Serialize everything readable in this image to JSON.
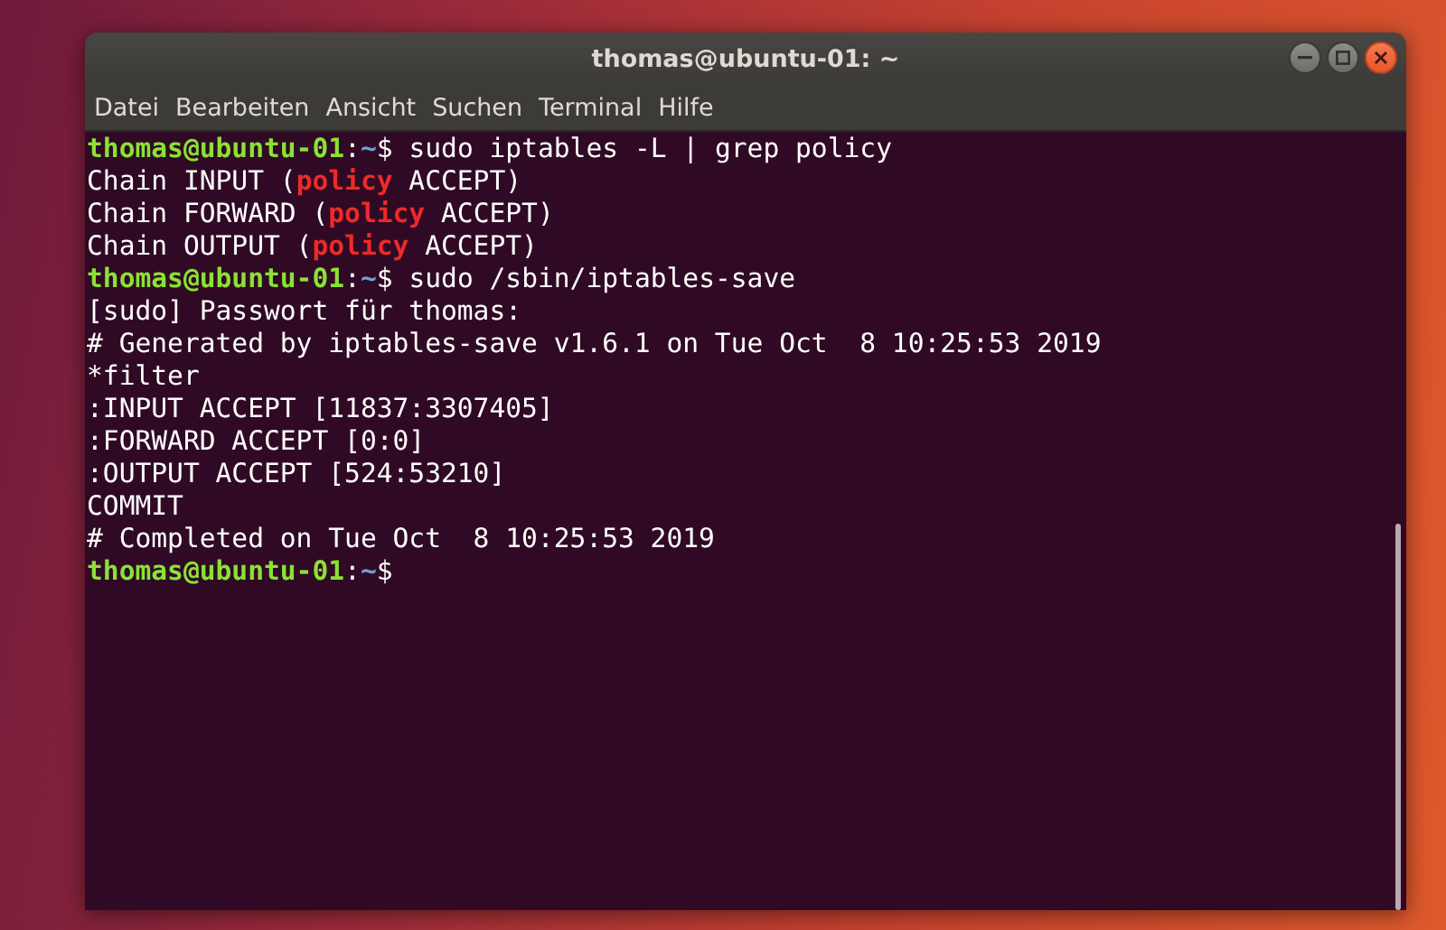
{
  "window": {
    "title": "thomas@ubuntu-01: ~"
  },
  "menu": [
    "Datei",
    "Bearbeiten",
    "Ansicht",
    "Suchen",
    "Terminal",
    "Hilfe"
  ],
  "lines": [
    {
      "kind": "prompt",
      "user_host": "thomas@ubuntu-01",
      "separator": ":",
      "path": "~",
      "symbol": "$",
      "command": " sudo iptables -L | grep policy"
    },
    {
      "kind": "output",
      "segments": [
        {
          "kind": "plain",
          "text": "Chain INPUT ("
        },
        {
          "kind": "match",
          "text": "policy"
        },
        {
          "kind": "plain",
          "text": " ACCEPT)"
        }
      ]
    },
    {
      "kind": "output",
      "segments": [
        {
          "kind": "plain",
          "text": "Chain FORWARD ("
        },
        {
          "kind": "match",
          "text": "policy"
        },
        {
          "kind": "plain",
          "text": " ACCEPT)"
        }
      ]
    },
    {
      "kind": "output",
      "segments": [
        {
          "kind": "plain",
          "text": "Chain OUTPUT ("
        },
        {
          "kind": "match",
          "text": "policy"
        },
        {
          "kind": "plain",
          "text": " ACCEPT)"
        }
      ]
    },
    {
      "kind": "prompt",
      "user_host": "thomas@ubuntu-01",
      "separator": ":",
      "path": "~",
      "symbol": "$",
      "command": " sudo /sbin/iptables-save"
    },
    {
      "kind": "output",
      "segments": [
        {
          "kind": "plain",
          "text": "[sudo] Passwort für thomas:"
        }
      ]
    },
    {
      "kind": "output",
      "segments": [
        {
          "kind": "plain",
          "text": "# Generated by iptables-save v1.6.1 on Tue Oct  8 10:25:53 2019"
        }
      ]
    },
    {
      "kind": "output",
      "segments": [
        {
          "kind": "plain",
          "text": "*filter"
        }
      ]
    },
    {
      "kind": "output",
      "segments": [
        {
          "kind": "plain",
          "text": ":INPUT ACCEPT [11837:3307405]"
        }
      ]
    },
    {
      "kind": "output",
      "segments": [
        {
          "kind": "plain",
          "text": ":FORWARD ACCEPT [0:0]"
        }
      ]
    },
    {
      "kind": "output",
      "segments": [
        {
          "kind": "plain",
          "text": ":OUTPUT ACCEPT [524:53210]"
        }
      ]
    },
    {
      "kind": "output",
      "segments": [
        {
          "kind": "plain",
          "text": "COMMIT"
        }
      ]
    },
    {
      "kind": "output",
      "segments": [
        {
          "kind": "plain",
          "text": "# Completed on Tue Oct  8 10:25:53 2019"
        }
      ]
    },
    {
      "kind": "prompt",
      "user_host": "thomas@ubuntu-01",
      "separator": ":",
      "path": "~",
      "symbol": "$"
    }
  ]
}
